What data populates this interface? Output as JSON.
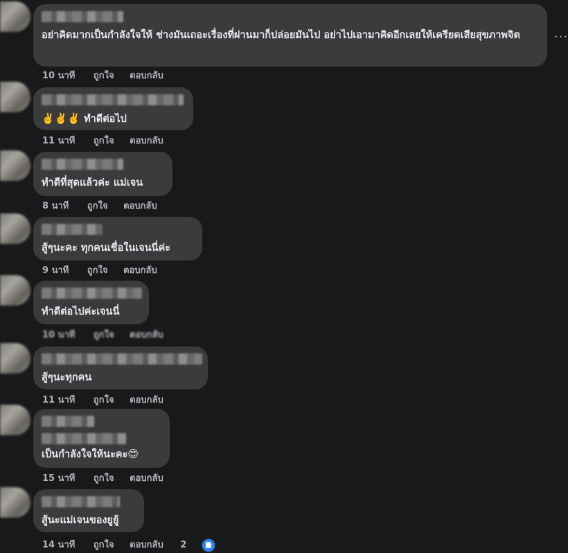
{
  "comments": [
    {
      "text": "อย่าคิดมากเป็นกำลังใจให้ ช่างมันเถอะเรื่องที่ผ่านมาก็ปล่อยมันไป อย่าไปเอามาคิดอีกเลยให้เครียดเสียสุขภาพจิต",
      "time": "10 นาที",
      "like": "ถูกใจ",
      "reply": "ตอบกลับ"
    },
    {
      "emoji": "✌️✌️✌️",
      "text": "ทำดีต่อไป",
      "time": "11 นาที",
      "like": "ถูกใจ",
      "reply": "ตอบกลับ"
    },
    {
      "text": "ทำดีที่สุดแล้วค่ะ แม่เจน",
      "time": "8 นาที",
      "like": "ถูกใจ",
      "reply": "ตอบกลับ"
    },
    {
      "text": "สู้ๆนะคะ ทุกคนเชื่อในเจนนี่ค่ะ",
      "time": "9 นาที",
      "like": "ถูกใจ",
      "reply": "ตอบกลับ"
    },
    {
      "text": "ทำดีต่อไปค่ะเจนนี่",
      "time": "10 นาที",
      "like": "ถูกใจ",
      "reply": "ตอบกลับ"
    },
    {
      "text": "สู้ๆนะทุกคน",
      "time": "11 นาที",
      "like": "ถูกใจ",
      "reply": "ตอบกลับ"
    },
    {
      "text": "เป็นกำลังใจให้นะคะ",
      "emoji": "😍",
      "time": "15 นาที",
      "like": "ถูกใจ",
      "reply": "ตอบกลับ"
    },
    {
      "text": "สู้นะแม่เจนของยูยู้",
      "time": "14 นาที",
      "like": "ถูกใจ",
      "reply": "ตอบกลับ",
      "reaction_count": "2",
      "reaction_icon": "like-icon"
    }
  ],
  "more_label": "..."
}
